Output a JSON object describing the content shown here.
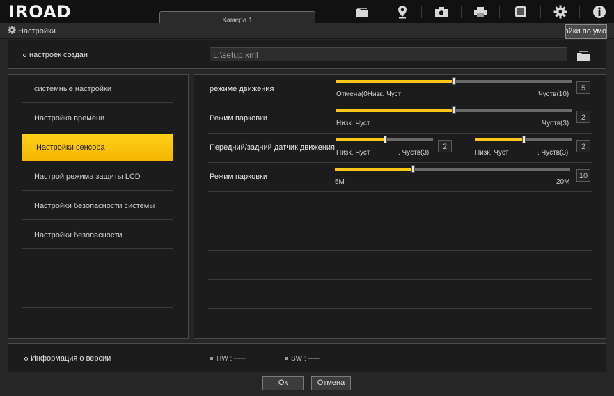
{
  "app": {
    "logo": "IROAD",
    "camera_tab": "Камера 1",
    "toolbar_icons": [
      "folder-icon",
      "map-pin-icon",
      "camera-icon",
      "printer-icon",
      "screen-icon",
      "gear-icon",
      "info-icon"
    ]
  },
  "window": {
    "title": "Настройки",
    "default_button": "Настройки по умо."
  },
  "file": {
    "label": "настроек создан",
    "path": "L:\\setup.xml"
  },
  "menu": {
    "items": [
      {
        "label": "системные настройки"
      },
      {
        "label": "Настройка времени"
      },
      {
        "label": "Настройки сенсора"
      },
      {
        "label": "Настрой режима защиты LCD"
      },
      {
        "label": "Настройки безопасности системы"
      },
      {
        "label": "Настройки безопасности"
      }
    ],
    "active_index": 2
  },
  "sensor": {
    "motion": {
      "label": "режиме движения",
      "min_label": "Отмена(0Низк. Чуст",
      "max_label": "Чуств(10)",
      "value": "5",
      "level": 0.5
    },
    "parking": {
      "label": "Режим парковки",
      "min_label": "Низк. Чуст",
      "max_label": ". Чуств(3)",
      "value": "2",
      "level": 0.5
    },
    "front_rear": {
      "label": "Передний/задний датчик движения",
      "front": {
        "min_label": "Низк. Чуст",
        "max_label": ". Чуств(3)",
        "value": "2",
        "level": 0.5
      },
      "rear": {
        "min_label": "Низк. Чуст",
        "max_label": ". Чуств(3)",
        "value": "2",
        "level": 0.5
      }
    },
    "parking_duration": {
      "label": "Режим парковки",
      "min_label": "5M",
      "max_label": "20M",
      "value": "10",
      "level": 0.33
    }
  },
  "version": {
    "label": "Информация о версии",
    "hw": "HW : -----",
    "sw": "SW : -----"
  },
  "buttons": {
    "ok": "Ок",
    "cancel": "Отмена"
  },
  "colors": {
    "accent": "#ffc61a",
    "background": "#262626",
    "panel": "#1c1c1c"
  }
}
